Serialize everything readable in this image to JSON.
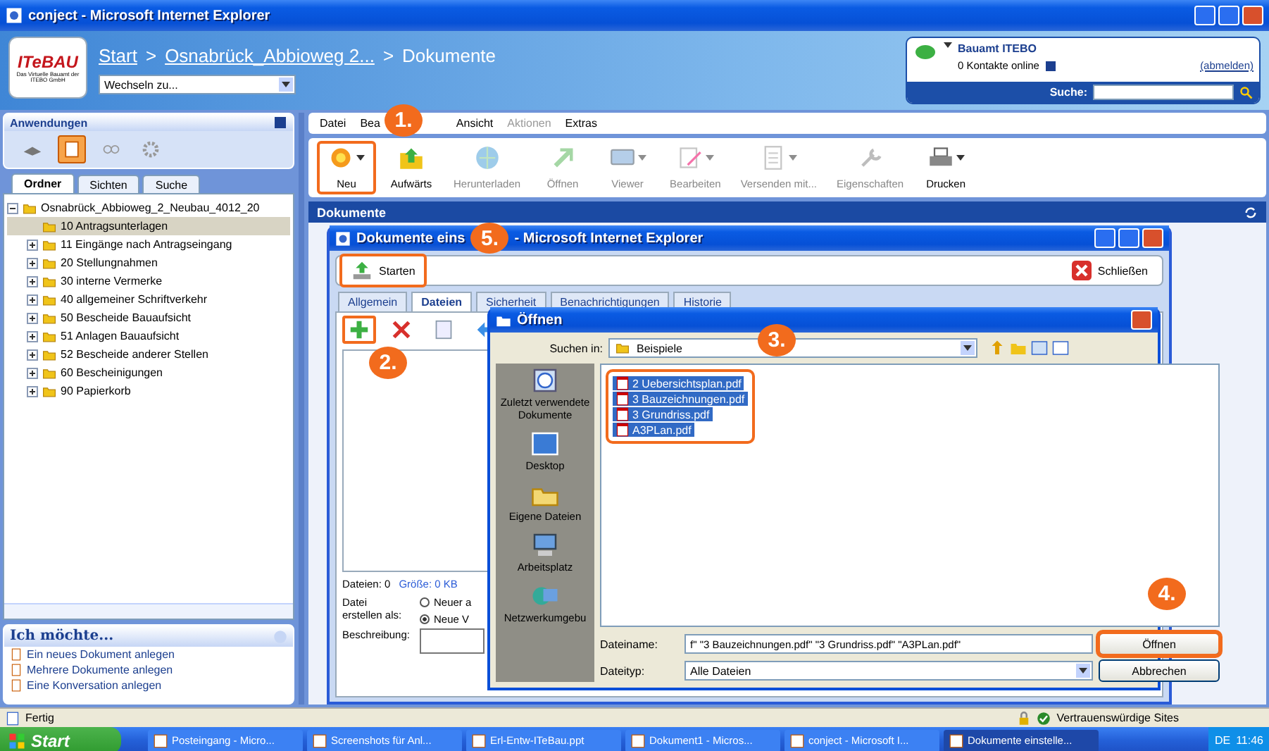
{
  "window": {
    "title": "conject - Microsoft Internet Explorer"
  },
  "header": {
    "logo": "ITeBAU",
    "logo_subtitle": "Das Virtuelle Bauamt der ITEBO GmbH",
    "breadcrumb": [
      {
        "label": "Start"
      },
      {
        "sep": ">",
        "label": "Osnabrück_Abbioweg 2..."
      },
      {
        "sep": ">",
        "label": "Dokumente"
      }
    ],
    "switch_select": "Wechseln zu...",
    "contact": {
      "name": "Bauamt ITEBO",
      "status": "0 Kontakte online",
      "logout": "(abmelden)"
    },
    "search_label": "Suche:"
  },
  "applications": {
    "title": "Anwendungen",
    "items": [
      {
        "selected": false
      },
      {
        "selected": true
      },
      {
        "selected": false
      },
      {
        "selected": false
      }
    ]
  },
  "left_tabs": [
    {
      "label": "Ordner",
      "selected": true
    },
    {
      "label": "Sichten",
      "selected": false
    },
    {
      "label": "Suche",
      "selected": false
    }
  ],
  "tree": [
    {
      "label": "Osnabrück_Abbioweg_2_Neubau_4012_20",
      "expanded": true,
      "selected": false,
      "children": [
        {
          "label": "10 Antragsunterlagen",
          "selected": true,
          "expandable": false
        },
        {
          "label": "11 Eingänge nach Antragseingang",
          "selected": false,
          "expandable": true
        },
        {
          "label": "20 Stellungnahmen",
          "selected": false,
          "expandable": true
        },
        {
          "label": "30 interne Vermerke",
          "selected": false,
          "expandable": true
        },
        {
          "label": "40 allgemeiner Schriftverkehr",
          "selected": false,
          "expandable": true
        },
        {
          "label": "50 Bescheide Bauaufsicht",
          "selected": false,
          "expandable": true
        },
        {
          "label": "51 Anlagen Bauaufsicht",
          "selected": false,
          "expandable": true
        },
        {
          "label": "52 Bescheide anderer Stellen",
          "selected": false,
          "expandable": true
        },
        {
          "label": "60 Bescheinigungen",
          "selected": false,
          "expandable": true
        },
        {
          "label": "90 Papierkorb",
          "selected": false,
          "expandable": true
        }
      ]
    }
  ],
  "quick_actions": {
    "title": "Ich möchte...",
    "items": [
      "Ein neues Dokument anlegen",
      "Mehrere Dokumente anlegen",
      "Eine Konversation anlegen"
    ]
  },
  "menu": [
    {
      "label": "Datei",
      "disabled": false
    },
    {
      "label": "Bea",
      "disabled": false
    },
    {
      "label": "Ansicht",
      "disabled": false
    },
    {
      "label": "Aktionen",
      "disabled": true
    },
    {
      "label": "Extras",
      "disabled": false
    }
  ],
  "toolbar": [
    {
      "label": "Neu",
      "disabled": false,
      "dropdown": true,
      "highlighted": true
    },
    {
      "label": "Aufwärts",
      "disabled": false,
      "dropdown": false,
      "highlighted": false
    },
    {
      "label": "Herunterladen",
      "disabled": true,
      "dropdown": false,
      "highlighted": false
    },
    {
      "label": "Öffnen",
      "disabled": true,
      "dropdown": false,
      "highlighted": false
    },
    {
      "label": "Viewer",
      "disabled": true,
      "dropdown": true,
      "highlighted": false
    },
    {
      "label": "Bearbeiten",
      "disabled": true,
      "dropdown": true,
      "highlighted": false
    },
    {
      "label": "Versenden mit...",
      "disabled": true,
      "dropdown": true,
      "highlighted": false
    },
    {
      "label": "Eigenschaften",
      "disabled": true,
      "dropdown": false,
      "highlighted": false
    },
    {
      "label": "Drucken",
      "disabled": false,
      "dropdown": true,
      "highlighted": false
    }
  ],
  "section": {
    "title": "Dokumente"
  },
  "dialog": {
    "title_start": "Dokumente eins",
    "step": "5.",
    "title_end": "- Microsoft Internet Explorer",
    "start_button": {
      "label": "Starten",
      "highlighted": true
    },
    "close_button": "Schließen",
    "tabs": [
      {
        "label": "Allgemein",
        "selected": false
      },
      {
        "label": "Dateien",
        "selected": true
      },
      {
        "label": "Sicherheit",
        "selected": false
      },
      {
        "label": "Benachrichtigungen",
        "selected": false
      },
      {
        "label": "Historie",
        "selected": false
      }
    ],
    "add_highlighted": true,
    "files_count": "Dateien: 0",
    "files_size": "Größe: 0 KB",
    "create_as_label": "Datei erstellen als:",
    "create_options": [
      {
        "label": "Neuer a",
        "selected": false
      },
      {
        "label": "Neue V",
        "selected": true
      }
    ],
    "description_label": "Beschreibung:"
  },
  "open_dialog": {
    "title": "Öffnen",
    "look_in_label": "Suchen in:",
    "look_in": "Beispiele",
    "places": [
      "Zuletzt verwendete Dokumente",
      "Desktop",
      "Eigene Dateien",
      "Arbeitsplatz",
      "Netzwerkumgebu"
    ],
    "files": [
      {
        "name": "2 Uebersichtsplan.pdf",
        "selected": true
      },
      {
        "name": "3 Bauzeichnungen.pdf",
        "selected": true
      },
      {
        "name": "3 Grundriss.pdf",
        "selected": true
      },
      {
        "name": "A3PLan.pdf",
        "selected": true
      }
    ],
    "files_highlighted": true,
    "filename_label": "Dateiname:",
    "filename": "f\" \"3 Bauzeichnungen.pdf\" \"3 Grundriss.pdf\" \"A3PLan.pdf\"",
    "filetype_label": "Dateityp:",
    "filetype": "Alle Dateien",
    "buttons": [
      {
        "label": "Öffnen",
        "highlighted": true
      },
      {
        "label": "Abbrechen",
        "highlighted": false
      }
    ]
  },
  "callouts": [
    "1.",
    "2.",
    "3.",
    "4."
  ],
  "status_bar": {
    "text": "Fertig",
    "zone": "Vertrauenswürdige Sites"
  },
  "taskbar": {
    "start": "Start",
    "items": [
      {
        "label": "Posteingang - Micro...",
        "selected": false
      },
      {
        "label": "Screenshots für Anl...",
        "selected": false
      },
      {
        "label": "Erl-Entw-ITeBau.ppt",
        "selected": false
      },
      {
        "label": "Dokument1 - Micros...",
        "selected": false
      },
      {
        "label": "conject - Microsoft I...",
        "selected": false
      },
      {
        "label": "Dokumente einstelle...",
        "selected": true
      }
    ],
    "language": "DE",
    "clock": "11:46"
  }
}
